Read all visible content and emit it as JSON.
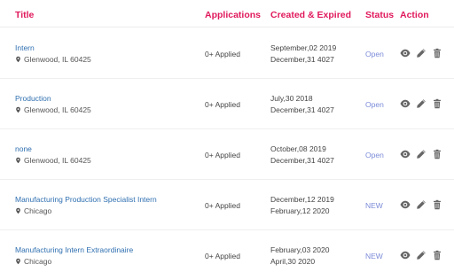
{
  "header": {
    "title": "Title",
    "applications": "Applications",
    "dates": "Created & Expired",
    "status": "Status",
    "action": "Action"
  },
  "rows": [
    {
      "title": "Intern",
      "location": "Glenwood, IL 60425",
      "applied": "0+ Applied",
      "created": "September,02 2019",
      "expired": "December,31 4027",
      "status": "Open"
    },
    {
      "title": "Production",
      "location": "Glenwood, IL 60425",
      "applied": "0+ Applied",
      "created": "July,30 2018",
      "expired": "December,31 4027",
      "status": "Open"
    },
    {
      "title": "none",
      "location": "Glenwood, IL 60425",
      "applied": "0+ Applied",
      "created": "October,08 2019",
      "expired": "December,31 4027",
      "status": "Open"
    },
    {
      "title": "Manufacturing Production Specialist Intern",
      "location": "Chicago",
      "applied": "0+ Applied",
      "created": "December,12 2019",
      "expired": "February,12 2020",
      "status": "NEW"
    },
    {
      "title": "Manufacturing Intern Extraordinaire",
      "location": "Chicago",
      "applied": "0+ Applied",
      "created": "February,03 2020",
      "expired": "April,30 2020",
      "status": "NEW"
    }
  ],
  "icons": {
    "location": "map-pin-icon",
    "view": "eye-icon",
    "edit": "pencil-icon",
    "delete": "trash-icon"
  },
  "colors": {
    "header": "#e0195c",
    "link": "#2f6fb0",
    "status": "#7b8bd8",
    "icon": "#666666"
  }
}
